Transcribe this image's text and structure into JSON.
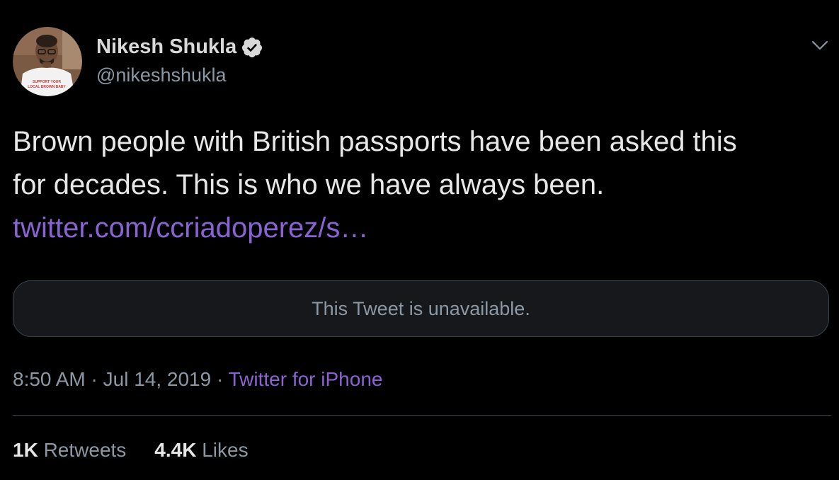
{
  "author": {
    "name": "Nikesh Shukla",
    "handle": "@nikeshshukla",
    "verified": true,
    "avatar_icon": "profile-photo",
    "avatar_shirt_text_line1": "SUPPORT YOUR",
    "avatar_shirt_text_line2": "LOCAL BROWN BABY"
  },
  "menu_icon": "chevron-down-icon",
  "tweet": {
    "line1": "Brown people with British passports have been asked this",
    "line2": "for decades. This is who we have always been.",
    "link": "twitter.com/ccriadoperez/s…"
  },
  "quoted_tweet": {
    "text": "This Tweet is unavailable."
  },
  "meta": {
    "time": "8:50 AM",
    "separator1": " · ",
    "date": "Jul 14, 2019",
    "separator2": " · ",
    "source": "Twitter for iPhone"
  },
  "stats": {
    "retweets_count": "1K",
    "retweets_label": "Retweets",
    "likes_count": "4.4K",
    "likes_label": "Likes"
  },
  "colors": {
    "background": "#000000",
    "link": "#8a63d2",
    "secondary_text": "#8b98a5",
    "border": "#38444d"
  }
}
